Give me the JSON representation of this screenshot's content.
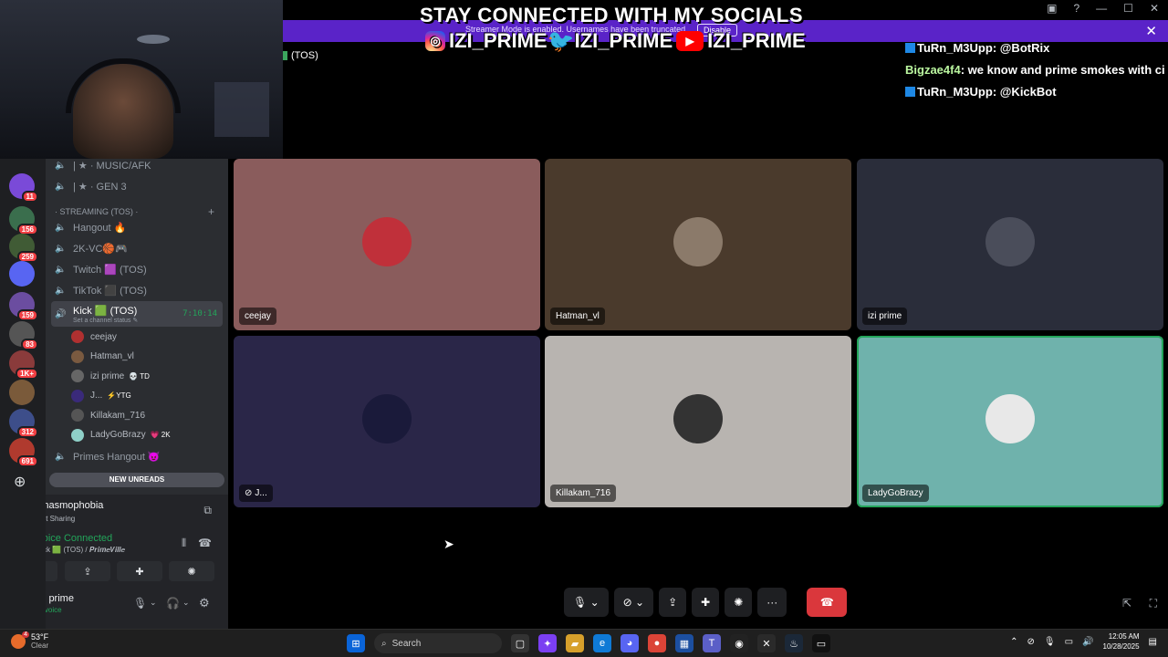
{
  "overlay": {
    "banner_title": "STAY CONNECTED WITH MY SOCIALS",
    "social_handle": "IZI_PRIME",
    "notice_text": "Streamer Mode is enabled. Usernames have been truncated.",
    "disable_label": "Disable",
    "tos_tag": "(TOS)",
    "chat": [
      {
        "name": "TuRn_M3Upp",
        "message": ": @BotRix"
      },
      {
        "name": "Bigzae4f4",
        "message": ": we know and prime smokes with ci"
      },
      {
        "name": "TuRn_M3Upp",
        "message": ": @KickBot"
      }
    ]
  },
  "servers": [
    {
      "badge": "11",
      "color": "#7a4ad8"
    },
    {
      "badge": "156",
      "color": "#3a6e4d"
    },
    {
      "badge": "259",
      "color": "#405b35"
    },
    {
      "badge": "",
      "color": "#5865f2"
    },
    {
      "badge": "159",
      "color": "#6b4da0"
    },
    {
      "badge": "83",
      "color": "#555"
    },
    {
      "badge": "1K+",
      "color": "#8a3b3b"
    },
    {
      "badge": "",
      "color": "#7a5a3a"
    },
    {
      "badge": "312",
      "color": "#3d4e8a"
    },
    {
      "badge": "691",
      "color": "#b03a2e"
    }
  ],
  "channels": {
    "top": [
      {
        "name": "| ★ · MUSIC/AFK"
      },
      {
        "name": "| ★ · GEN 3"
      }
    ],
    "category": "· STREAMING (TOS) ·",
    "list": [
      {
        "name": "Hangout 🔥"
      },
      {
        "name": "2K-VC🏀🎮"
      },
      {
        "name": "Twitch 🟪 (TOS)"
      },
      {
        "name": "TikTok ⬛ (TOS)"
      }
    ],
    "active": {
      "name": "Kick 🟩 (TOS)",
      "status": "Set a channel status ✎",
      "timer": "7:10:14"
    },
    "members": [
      {
        "name": "ceejay",
        "tag": "",
        "color": "#b03030"
      },
      {
        "name": "Hatman_vl",
        "tag": "",
        "color": "#7a5a40"
      },
      {
        "name": "izi prime",
        "tag": "💀 TD",
        "color": "#666"
      },
      {
        "name": "J...",
        "tag": "⚡YTG",
        "color": "#3a2a7a"
      },
      {
        "name": "Killakam_716",
        "tag": "",
        "color": "#555"
      },
      {
        "name": "LadyGoBrazy",
        "tag": "💗 2K",
        "color": "#8fd0c8"
      }
    ],
    "after": [
      {
        "name": "Primes Hangout 😈"
      }
    ],
    "new_unreads": "NEW UNREADS"
  },
  "panel": {
    "activity_title": "Phasmophobia",
    "activity_sub": "Not Sharing",
    "voice_title": "Voice Connected",
    "voice_sub": "Kick 🟩 (TOS) / 𝑷𝒓𝒊𝒎𝒆𝑽𝒊𝒍𝒍𝒆",
    "user_name": "izi prime",
    "user_status": "In voice"
  },
  "tiles": [
    {
      "name": "ceejay",
      "bg": "#8a5c5c",
      "avatar": "#c0303a"
    },
    {
      "name": "Hatman_vl",
      "bg": "#4a3a2c",
      "avatar": "#8b7a6a"
    },
    {
      "name": "izi prime",
      "bg": "#2a2d3a",
      "avatar": "#4a4d5a"
    },
    {
      "name": "J...",
      "bg": "#2a2648",
      "avatar": "#1a1a3a"
    },
    {
      "name": "Killakam_716",
      "bg": "#b8b4b0",
      "avatar": "#333"
    },
    {
      "name": "LadyGoBrazy",
      "bg": "#6fb2ac",
      "avatar": "#e8e8e8"
    }
  ],
  "taskbar": {
    "weather_temp": "53°F",
    "weather_desc": "Clear",
    "weather_badge": "4",
    "search_placeholder": "Search",
    "time": "12:05 AM",
    "date": "10/28/2025"
  }
}
